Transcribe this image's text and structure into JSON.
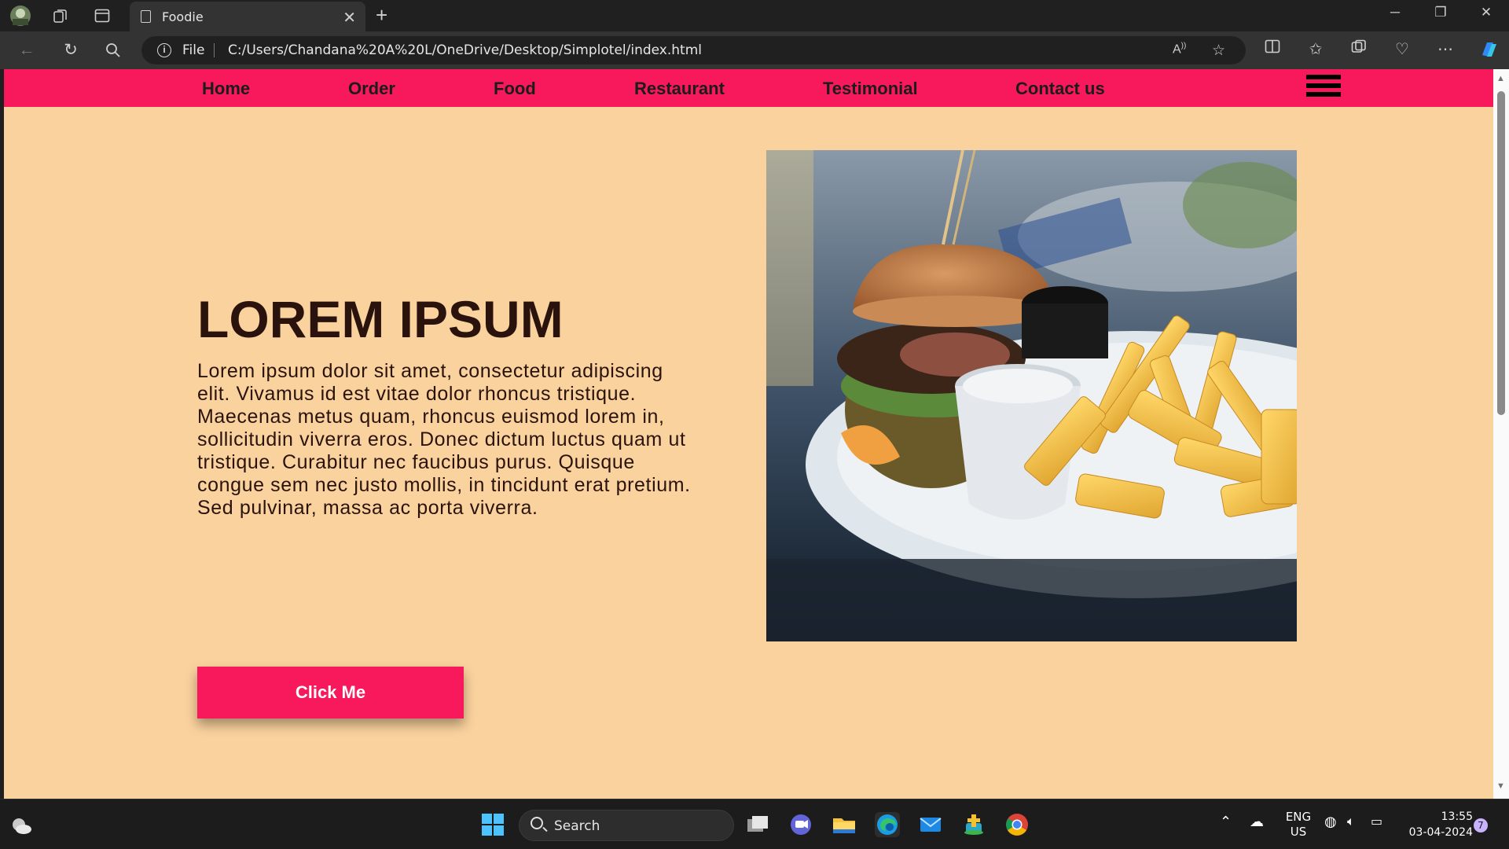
{
  "browser": {
    "tab_title": "Foodie",
    "address_prefix": "File",
    "url": "C:/Users/Chandana%20A%20L/OneDrive/Desktop/Simplotel/index.html"
  },
  "page": {
    "nav": {
      "items": [
        {
          "label": "Home"
        },
        {
          "label": "Order"
        },
        {
          "label": "Food"
        },
        {
          "label": "Restaurant"
        },
        {
          "label": "Testimonial"
        },
        {
          "label": "Contact us"
        }
      ]
    },
    "hero": {
      "title": "LOREM IPSUM",
      "body": "Lorem ipsum dolor sit amet, consectetur adipiscing elit. Vivamus id est vitae dolor rhoncus tristique. Maecenas metus quam, rhoncus euismod lorem in, sollicitudin viverra eros. Donec dictum luctus quam ut tristique. Curabitur nec faucibus purus. Quisque congue sem nec justo mollis, in tincidunt erat pretium. Sed pulvinar, massa ac porta viverra.",
      "cta_label": "Click Me",
      "image_subject": "burger-and-fries-photo"
    },
    "colors": {
      "nav_bg": "#f7195b",
      "page_bg": "#fad29e",
      "button_bg": "#f7195b",
      "text": "#2a130d"
    }
  },
  "taskbar": {
    "search_label": "Search",
    "language": "ENG",
    "region": "US",
    "time": "13:55",
    "date": "03-04-2024",
    "notification_count": "7"
  }
}
